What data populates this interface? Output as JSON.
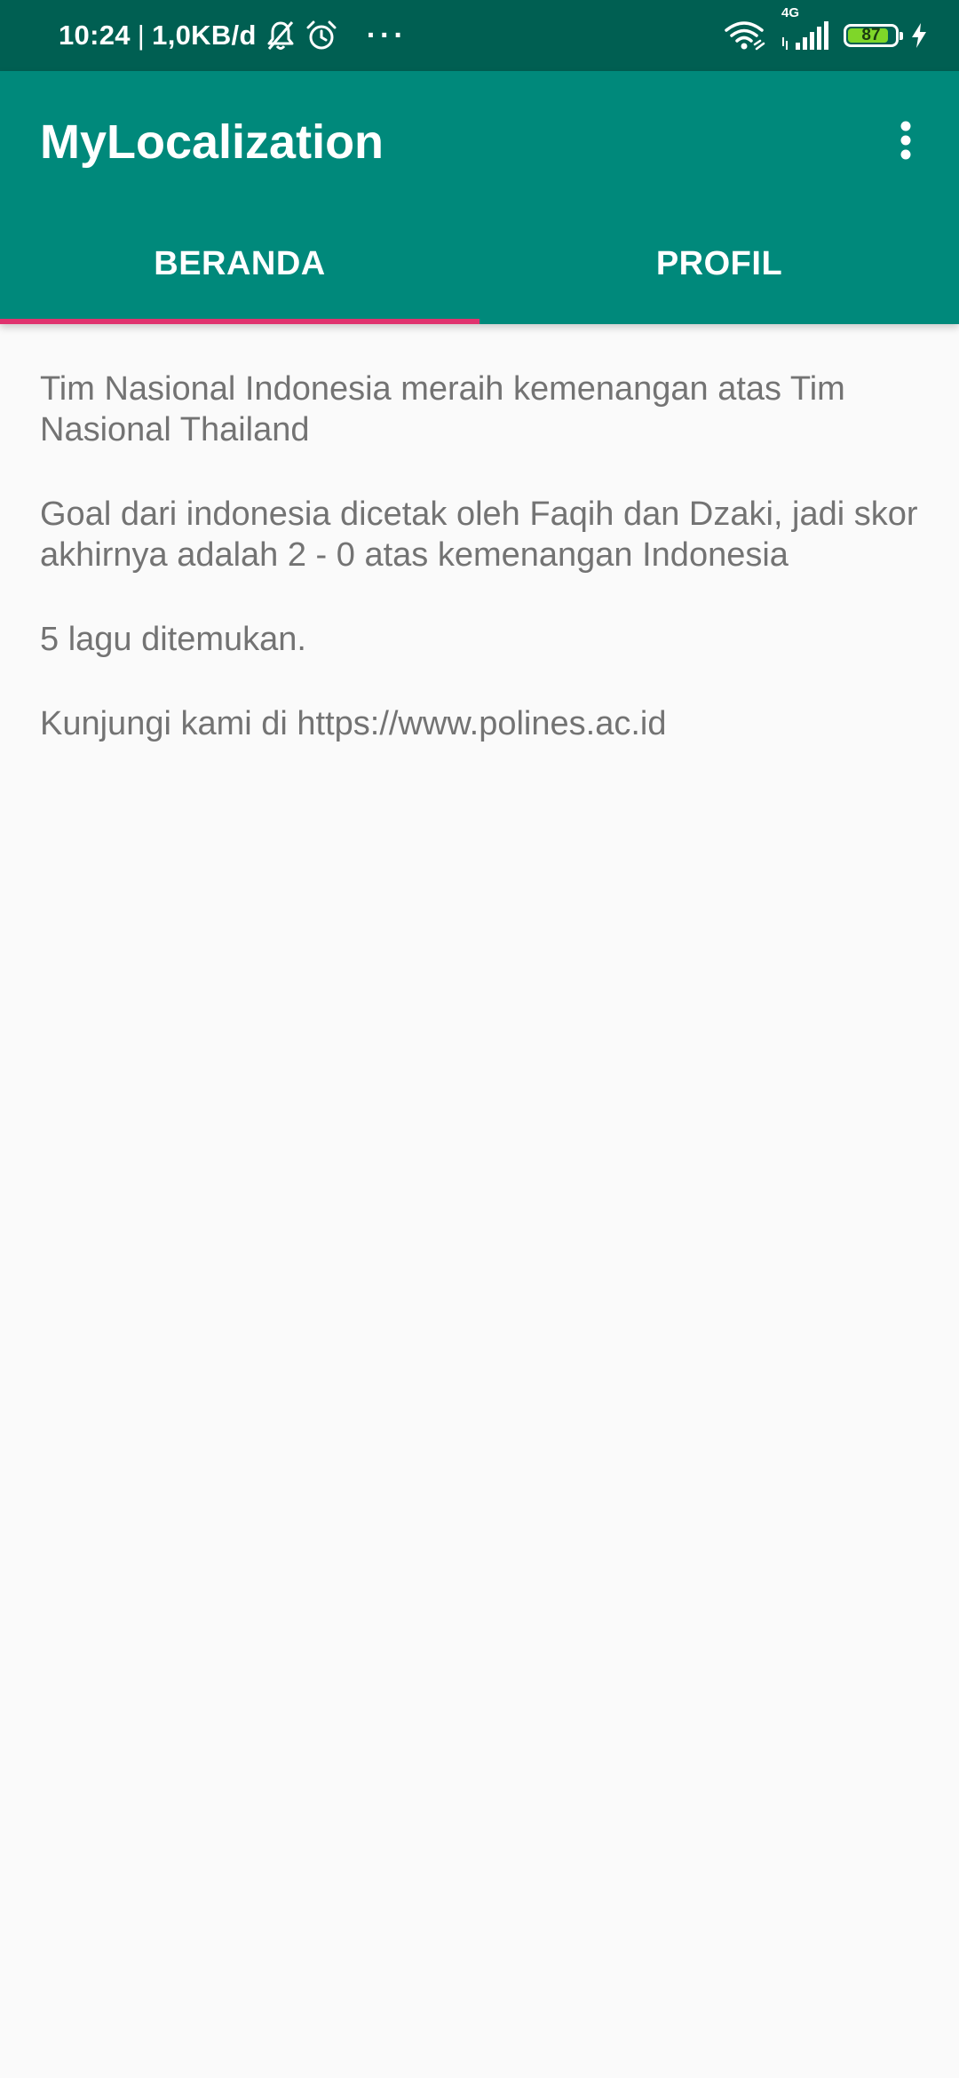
{
  "status_bar": {
    "time": "10:24",
    "separator": "|",
    "network_speed": "1,0KB/d",
    "left_icons": [
      "bell-muted-icon",
      "alarm-icon"
    ],
    "more_dots": "···",
    "right_icons": [
      "wifi-icon",
      "signal-4g-icon",
      "battery-icon",
      "charging-icon"
    ],
    "network_type": "4G",
    "battery_level": "87",
    "battery_fraction": 0.87
  },
  "app_bar": {
    "title": "MyLocalization",
    "menu_icon": "more-vert-icon",
    "background_color": "#00897b"
  },
  "tabs": [
    {
      "label": "BERANDA",
      "selected": true
    },
    {
      "label": "PROFIL",
      "selected": false
    }
  ],
  "indicator_color": "#e0336f",
  "content": {
    "paragraphs": [
      "Tim Nasional Indonesia meraih kemenangan atas Tim Nasional Thailand",
      "Goal dari indonesia dicetak oleh Faqih dan Dzaki, jadi skor akhirnya adalah 2 - 0 atas kemenangan Indonesia",
      "5 lagu ditemukan.",
      "Kunjungi kami di https://www.polines.ac.id"
    ]
  }
}
